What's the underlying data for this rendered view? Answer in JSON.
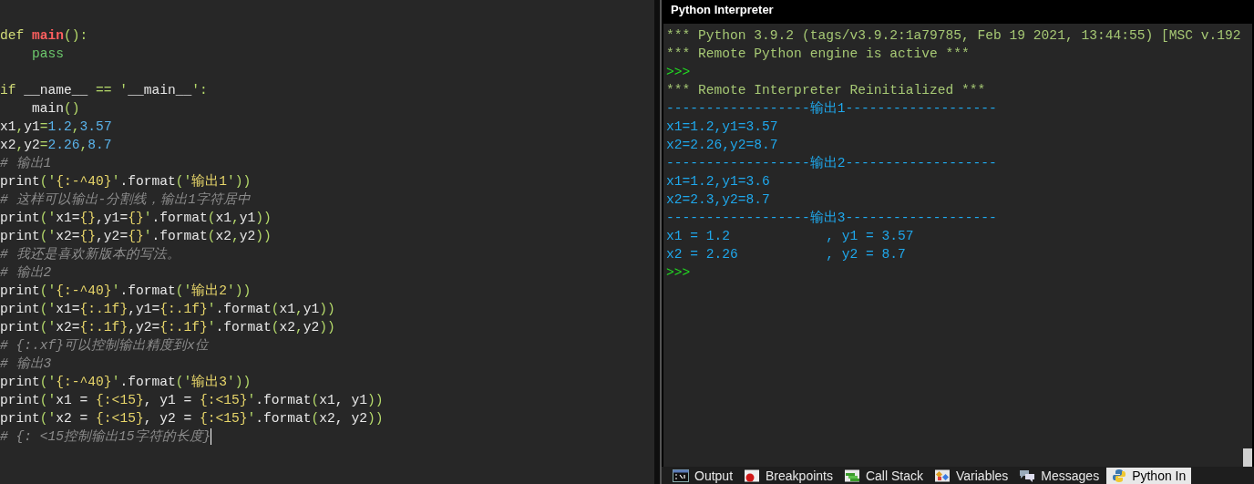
{
  "editor": {
    "lines": [
      {
        "kind": "code",
        "tokens": [
          {
            "kind": "keyword",
            "text": "def "
          },
          {
            "kind": "func",
            "text": "main"
          },
          {
            "kind": "punct",
            "text": "():"
          }
        ]
      },
      {
        "kind": "code",
        "tokens": [
          {
            "kind": "builtin",
            "text": "    pass"
          }
        ]
      },
      {
        "kind": "blank"
      },
      {
        "kind": "code",
        "tokens": [
          {
            "kind": "keyword",
            "text": "if"
          },
          {
            "kind": "plain",
            "text": " __name__ "
          },
          {
            "kind": "punct",
            "text": "== '"
          },
          {
            "kind": "plain",
            "text": "__main__"
          },
          {
            "kind": "punct",
            "text": "':"
          }
        ]
      },
      {
        "kind": "code",
        "tokens": [
          {
            "kind": "plain",
            "text": "    main"
          },
          {
            "kind": "punct",
            "text": "()"
          }
        ]
      },
      {
        "kind": "code",
        "tokens": [
          {
            "kind": "plain",
            "text": "x1"
          },
          {
            "kind": "punct",
            "text": ","
          },
          {
            "kind": "plain",
            "text": "y1"
          },
          {
            "kind": "punct",
            "text": "="
          },
          {
            "kind": "number",
            "text": "1.2"
          },
          {
            "kind": "punct",
            "text": ","
          },
          {
            "kind": "number",
            "text": "3.57"
          }
        ]
      },
      {
        "kind": "code",
        "tokens": [
          {
            "kind": "plain",
            "text": "x2"
          },
          {
            "kind": "punct",
            "text": ","
          },
          {
            "kind": "plain",
            "text": "y2"
          },
          {
            "kind": "punct",
            "text": "="
          },
          {
            "kind": "number",
            "text": "2.26"
          },
          {
            "kind": "punct",
            "text": ","
          },
          {
            "kind": "number",
            "text": "8.7"
          }
        ]
      },
      {
        "kind": "code",
        "tokens": [
          {
            "kind": "comment",
            "text": "# 输出1"
          }
        ]
      },
      {
        "kind": "code",
        "tokens": [
          {
            "kind": "plain",
            "text": "print"
          },
          {
            "kind": "punct",
            "text": "('"
          },
          {
            "kind": "fmt",
            "text": "{:-^40}"
          },
          {
            "kind": "punct",
            "text": "'"
          },
          {
            "kind": "plain",
            "text": ".format"
          },
          {
            "kind": "punct",
            "text": "('"
          },
          {
            "kind": "string",
            "text": "输出1"
          },
          {
            "kind": "punct",
            "text": "'))"
          }
        ]
      },
      {
        "kind": "code",
        "tokens": [
          {
            "kind": "comment",
            "text": "# 这样可以输出-分割线，输出1字符居中"
          }
        ]
      },
      {
        "kind": "code",
        "tokens": [
          {
            "kind": "plain",
            "text": "print"
          },
          {
            "kind": "punct",
            "text": "('"
          },
          {
            "kind": "plain",
            "text": "x1="
          },
          {
            "kind": "fmt",
            "text": "{}"
          },
          {
            "kind": "plain",
            "text": ",y1="
          },
          {
            "kind": "fmt",
            "text": "{}"
          },
          {
            "kind": "punct",
            "text": "'"
          },
          {
            "kind": "plain",
            "text": ".format"
          },
          {
            "kind": "punct",
            "text": "("
          },
          {
            "kind": "plain",
            "text": "x1"
          },
          {
            "kind": "punct",
            "text": ","
          },
          {
            "kind": "plain",
            "text": "y1"
          },
          {
            "kind": "punct",
            "text": "))"
          }
        ]
      },
      {
        "kind": "code",
        "tokens": [
          {
            "kind": "plain",
            "text": "print"
          },
          {
            "kind": "punct",
            "text": "('"
          },
          {
            "kind": "plain",
            "text": "x2="
          },
          {
            "kind": "fmt",
            "text": "{}"
          },
          {
            "kind": "plain",
            "text": ",y2="
          },
          {
            "kind": "fmt",
            "text": "{}"
          },
          {
            "kind": "punct",
            "text": "'"
          },
          {
            "kind": "plain",
            "text": ".format"
          },
          {
            "kind": "punct",
            "text": "("
          },
          {
            "kind": "plain",
            "text": "x2"
          },
          {
            "kind": "punct",
            "text": ","
          },
          {
            "kind": "plain",
            "text": "y2"
          },
          {
            "kind": "punct",
            "text": "))"
          }
        ]
      },
      {
        "kind": "code",
        "tokens": [
          {
            "kind": "comment",
            "text": "# 我还是喜欢新版本的写法。"
          }
        ]
      },
      {
        "kind": "code",
        "tokens": [
          {
            "kind": "comment",
            "text": "# 输出2"
          }
        ]
      },
      {
        "kind": "code",
        "tokens": [
          {
            "kind": "plain",
            "text": "print"
          },
          {
            "kind": "punct",
            "text": "('"
          },
          {
            "kind": "fmt",
            "text": "{:-^40}"
          },
          {
            "kind": "punct",
            "text": "'"
          },
          {
            "kind": "plain",
            "text": ".format"
          },
          {
            "kind": "punct",
            "text": "('"
          },
          {
            "kind": "string",
            "text": "输出2"
          },
          {
            "kind": "punct",
            "text": "'))"
          }
        ]
      },
      {
        "kind": "code",
        "tokens": [
          {
            "kind": "plain",
            "text": "print"
          },
          {
            "kind": "punct",
            "text": "('"
          },
          {
            "kind": "plain",
            "text": "x1="
          },
          {
            "kind": "fmt",
            "text": "{:.1f}"
          },
          {
            "kind": "plain",
            "text": ",y1="
          },
          {
            "kind": "fmt",
            "text": "{:.1f}"
          },
          {
            "kind": "punct",
            "text": "'"
          },
          {
            "kind": "plain",
            "text": ".format"
          },
          {
            "kind": "punct",
            "text": "("
          },
          {
            "kind": "plain",
            "text": "x1"
          },
          {
            "kind": "punct",
            "text": ","
          },
          {
            "kind": "plain",
            "text": "y1"
          },
          {
            "kind": "punct",
            "text": "))"
          }
        ]
      },
      {
        "kind": "code",
        "tokens": [
          {
            "kind": "plain",
            "text": "print"
          },
          {
            "kind": "punct",
            "text": "('"
          },
          {
            "kind": "plain",
            "text": "x2="
          },
          {
            "kind": "fmt",
            "text": "{:.1f}"
          },
          {
            "kind": "plain",
            "text": ",y2="
          },
          {
            "kind": "fmt",
            "text": "{:.1f}"
          },
          {
            "kind": "punct",
            "text": "'"
          },
          {
            "kind": "plain",
            "text": ".format"
          },
          {
            "kind": "punct",
            "text": "("
          },
          {
            "kind": "plain",
            "text": "x2"
          },
          {
            "kind": "punct",
            "text": ","
          },
          {
            "kind": "plain",
            "text": "y2"
          },
          {
            "kind": "punct",
            "text": "))"
          }
        ]
      },
      {
        "kind": "code",
        "tokens": [
          {
            "kind": "comment",
            "text": "# {:.xf}可以控制输出精度到x位"
          }
        ]
      },
      {
        "kind": "code",
        "tokens": [
          {
            "kind": "comment",
            "text": "# 输出3"
          }
        ]
      },
      {
        "kind": "code",
        "tokens": [
          {
            "kind": "plain",
            "text": "print"
          },
          {
            "kind": "punct",
            "text": "('"
          },
          {
            "kind": "fmt",
            "text": "{:-^40}"
          },
          {
            "kind": "punct",
            "text": "'"
          },
          {
            "kind": "plain",
            "text": ".format"
          },
          {
            "kind": "punct",
            "text": "('"
          },
          {
            "kind": "string",
            "text": "输出3"
          },
          {
            "kind": "punct",
            "text": "'))"
          }
        ]
      },
      {
        "kind": "code",
        "tokens": [
          {
            "kind": "plain",
            "text": "print"
          },
          {
            "kind": "punct",
            "text": "('"
          },
          {
            "kind": "plain",
            "text": "x1 = "
          },
          {
            "kind": "fmt",
            "text": "{:<15}"
          },
          {
            "kind": "plain",
            "text": ", y1 = "
          },
          {
            "kind": "fmt",
            "text": "{:<15}"
          },
          {
            "kind": "punct",
            "text": "'"
          },
          {
            "kind": "plain",
            "text": ".format"
          },
          {
            "kind": "punct",
            "text": "("
          },
          {
            "kind": "plain",
            "text": "x1, y1"
          },
          {
            "kind": "punct",
            "text": "))"
          }
        ]
      },
      {
        "kind": "code",
        "tokens": [
          {
            "kind": "plain",
            "text": "print"
          },
          {
            "kind": "punct",
            "text": "('"
          },
          {
            "kind": "plain",
            "text": "x2 = "
          },
          {
            "kind": "fmt",
            "text": "{:<15}"
          },
          {
            "kind": "plain",
            "text": ", y2 = "
          },
          {
            "kind": "fmt",
            "text": "{:<15}"
          },
          {
            "kind": "punct",
            "text": "'"
          },
          {
            "kind": "plain",
            "text": ".format"
          },
          {
            "kind": "punct",
            "text": "("
          },
          {
            "kind": "plain",
            "text": "x2, y2"
          },
          {
            "kind": "punct",
            "text": "))"
          }
        ]
      },
      {
        "kind": "code",
        "cursor": true,
        "tokens": [
          {
            "kind": "comment",
            "text": "# {: <15控制输出15字符的长度}"
          }
        ]
      }
    ]
  },
  "interpreter": {
    "title": "Python Interpreter",
    "lines": [
      {
        "kind": "banner",
        "text": "*** Python 3.9.2 (tags/v3.9.2:1a79785, Feb 19 2021, 13:44:55) [MSC v.192"
      },
      {
        "kind": "banner",
        "text": "*** Remote Python engine is active ***"
      },
      {
        "kind": "prompt",
        "text": ">>>"
      },
      {
        "kind": "banner",
        "text": "*** Remote Interpreter Reinitialized ***"
      },
      {
        "kind": "output",
        "text": "------------------输出1-------------------"
      },
      {
        "kind": "output",
        "text": "x1=1.2,y1=3.57"
      },
      {
        "kind": "output",
        "text": "x2=2.26,y2=8.7"
      },
      {
        "kind": "output",
        "text": "------------------输出2-------------------"
      },
      {
        "kind": "output",
        "text": "x1=1.2,y1=3.6"
      },
      {
        "kind": "output",
        "text": "x2=2.3,y2=8.7"
      },
      {
        "kind": "output",
        "text": "------------------输出3-------------------"
      },
      {
        "kind": "output",
        "text": "x1 = 1.2            , y1 = 3.57"
      },
      {
        "kind": "output",
        "text": "x2 = 2.26           , y2 = 8.7"
      },
      {
        "kind": "prompt",
        "text": ">>>"
      }
    ]
  },
  "bottom_tabs": [
    {
      "label": "Output",
      "kind": "console",
      "selected": false
    },
    {
      "label": "Breakpoints",
      "kind": "breakpoint",
      "selected": false
    },
    {
      "label": "Call Stack",
      "kind": "stack",
      "selected": false
    },
    {
      "label": "Variables",
      "kind": "variables",
      "selected": false
    },
    {
      "label": "Messages",
      "kind": "messages",
      "selected": false
    },
    {
      "label": "Python In",
      "kind": "python",
      "selected": true
    }
  ]
}
